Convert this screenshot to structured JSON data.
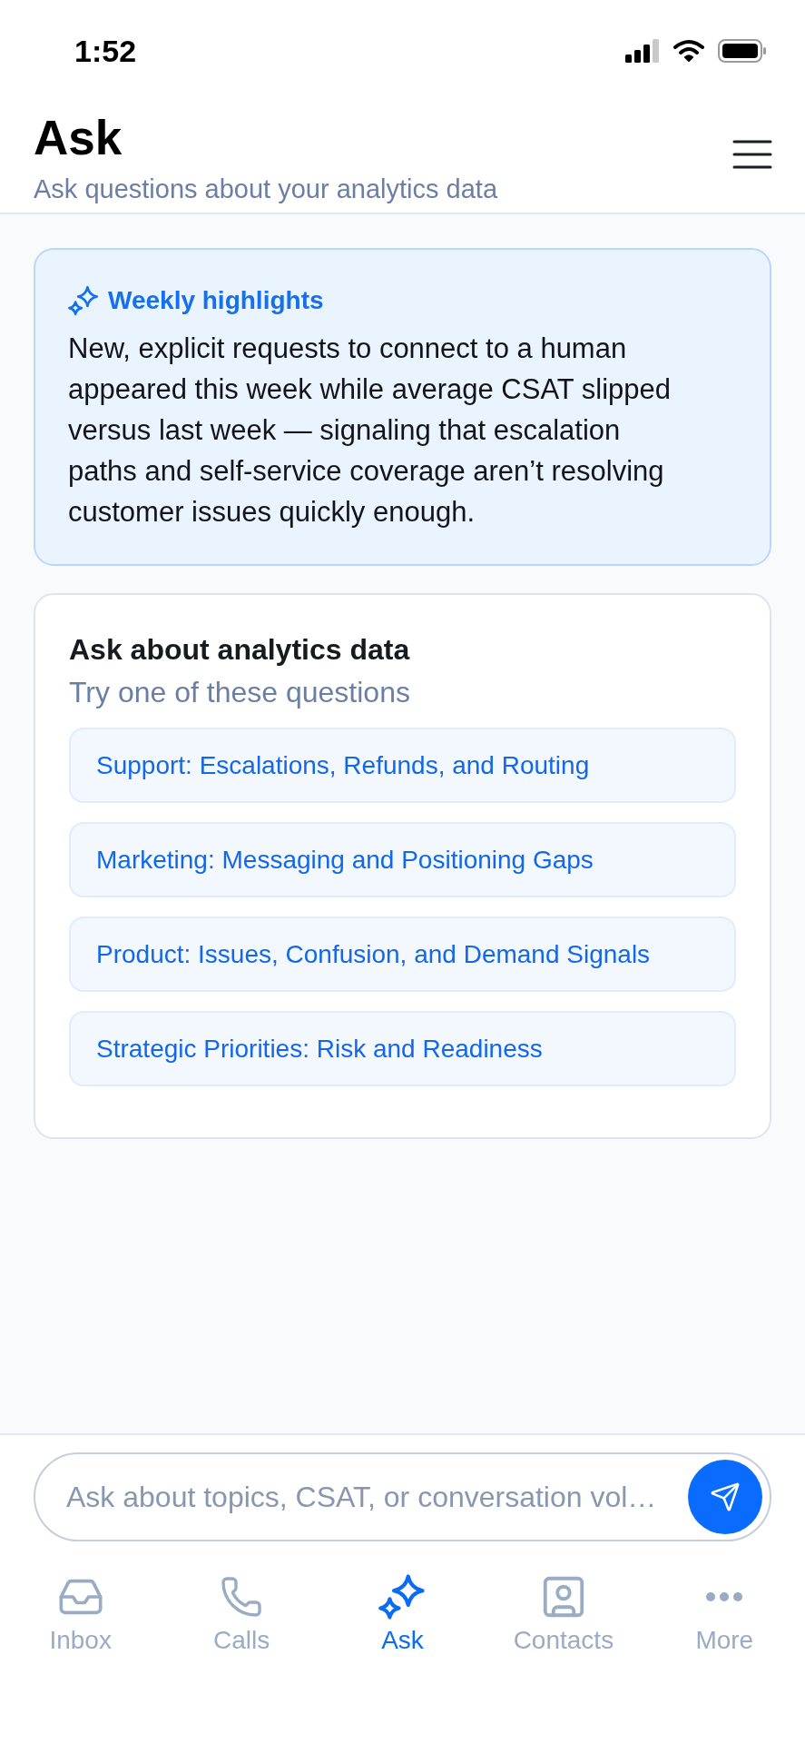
{
  "status_bar": {
    "time": "1:52"
  },
  "header": {
    "title": "Ask",
    "subtitle": "Ask questions about your analytics data"
  },
  "highlights": {
    "title": "Weekly highlights",
    "body": "New, explicit requests to connect to a human appeared this week while average CSAT slipped versus last week — signaling that escalation paths and self-service coverage aren’t resolving customer issues quickly enough."
  },
  "questions_card": {
    "title": "Ask about analytics data",
    "subtitle": "Try one of these questions",
    "questions": [
      "Support: Escalations, Refunds, and Routing",
      "Marketing: Messaging and Positioning Gaps",
      "Product: Issues, Confusion, and Demand Signals",
      "Strategic Priorities: Risk and Readiness"
    ]
  },
  "composer": {
    "placeholder": "Ask about topics, CSAT, or conversation vol…"
  },
  "tab_bar": [
    {
      "label": "Inbox",
      "kind": "inbox",
      "selected": false
    },
    {
      "label": "Calls",
      "kind": "calls",
      "selected": false
    },
    {
      "label": "Ask",
      "kind": "ask",
      "selected": true
    },
    {
      "label": "Contacts",
      "kind": "contacts",
      "selected": false
    },
    {
      "label": "More",
      "kind": "more",
      "selected": false
    }
  ]
}
